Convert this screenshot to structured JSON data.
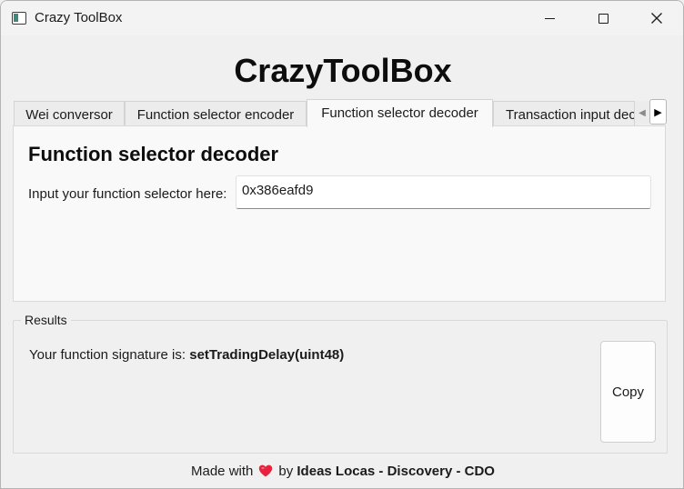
{
  "window": {
    "title": "Crazy ToolBox",
    "minimize_glyph": "minimize",
    "maximize_glyph": "maximize",
    "close_glyph": "×"
  },
  "app": {
    "title": "CrazyToolBox"
  },
  "tabs": [
    {
      "label": "Wei conversor",
      "active": false
    },
    {
      "label": "Function selector encoder",
      "active": false
    },
    {
      "label": "Function selector decoder",
      "active": true
    },
    {
      "label": "Transaction input decoder",
      "active": false
    }
  ],
  "tab_scroll": {
    "left": "◀",
    "right": "▶"
  },
  "panel": {
    "heading": "Function selector decoder",
    "input_label": "Input your function selector here:",
    "input_value": "0x386eafd9"
  },
  "results": {
    "label": "Results",
    "prefix": "Your function signature is: ",
    "signature": "setTradingDelay(uint48)",
    "copy_label": "Copy"
  },
  "footer": {
    "made_with": "Made with",
    "by": "by",
    "credit": "Ideas Locas - Discovery - CDO",
    "heart_color": "#e8213c"
  }
}
